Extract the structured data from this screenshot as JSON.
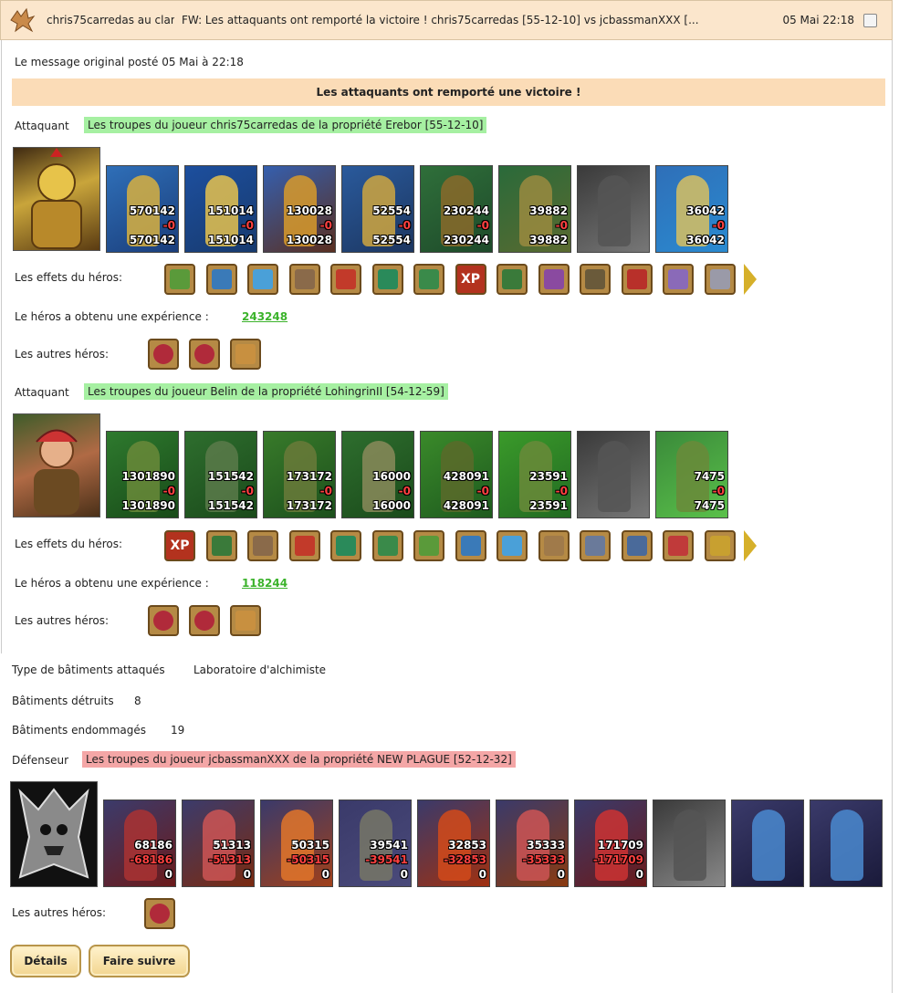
{
  "header": {
    "sender": "chris75carredas au clan",
    "subject": "FW: Les attaquants ont remporté la victoire ! chris75carredas [55-12-10] vs jcbassmanXXX [...",
    "date": "05 Mai 22:18"
  },
  "original_note": "Le message original posté 05 Mai à 22:18",
  "banner": "Les attaquants ont remporté une victoire !",
  "attackers": [
    {
      "label": "Attaquant",
      "troops": "Les troupes du joueur chris75carredas de la propriété Erebor [55-12-10]",
      "units": [
        {
          "a": "570142",
          "b": "-0",
          "c": "570142"
        },
        {
          "a": "151014",
          "b": "-0",
          "c": "151014"
        },
        {
          "a": "130028",
          "b": "-0",
          "c": "130028"
        },
        {
          "a": "52554",
          "b": "-0",
          "c": "52554"
        },
        {
          "a": "230244",
          "b": "-0",
          "c": "230244"
        },
        {
          "a": "39882",
          "b": "-0",
          "c": "39882"
        },
        {
          "a": "",
          "b": "",
          "c": ""
        },
        {
          "a": "36042",
          "b": "-0",
          "c": "36042"
        }
      ],
      "effects_label": "Les effets du héros:",
      "xp_label": "Le héros a obtenu une expérience :",
      "xp": "243248",
      "others_label": "Les autres héros:"
    },
    {
      "label": "Attaquant",
      "troops": "Les troupes du joueur Belin de la propriété LohingrinII [54-12-59]",
      "units": [
        {
          "a": "1301890",
          "b": "-0",
          "c": "1301890"
        },
        {
          "a": "151542",
          "b": "-0",
          "c": "151542"
        },
        {
          "a": "173172",
          "b": "-0",
          "c": "173172"
        },
        {
          "a": "16000",
          "b": "-0",
          "c": "16000"
        },
        {
          "a": "428091",
          "b": "-0",
          "c": "428091"
        },
        {
          "a": "23591",
          "b": "-0",
          "c": "23591"
        },
        {
          "a": "",
          "b": "",
          "c": ""
        },
        {
          "a": "7475",
          "b": "-0",
          "c": "7475"
        }
      ],
      "effects_label": "Les effets du héros:",
      "xp_label": "Le héros a obtenu une expérience :",
      "xp": "118244",
      "others_label": "Les autres héros:"
    }
  ],
  "buildings": {
    "type_label": "Type de bâtiments attaqués",
    "type_value": "Laboratoire d'alchimiste",
    "destroyed_label": "Bâtiments détruits",
    "destroyed_value": "8",
    "damaged_label": "Bâtiments endommagés",
    "damaged_value": "19"
  },
  "defender": {
    "label": "Défenseur",
    "troops": "Les troupes du joueur jcbassmanXXX de la propriété NEW PLAGUE [52-12-32]",
    "units": [
      {
        "a": "68186",
        "b": "-68186",
        "c": "0"
      },
      {
        "a": "51313",
        "b": "-51313",
        "c": "0"
      },
      {
        "a": "50315",
        "b": "-50315",
        "c": "0"
      },
      {
        "a": "39541",
        "b": "-39541",
        "c": "0"
      },
      {
        "a": "32853",
        "b": "-32853",
        "c": "0"
      },
      {
        "a": "35333",
        "b": "-35333",
        "c": "0"
      },
      {
        "a": "171709",
        "b": "-171709",
        "c": "0"
      },
      {
        "a": "",
        "b": "",
        "c": ""
      },
      {
        "a": "",
        "b": "",
        "c": ""
      },
      {
        "a": "",
        "b": "",
        "c": ""
      }
    ],
    "others_label": "Les autres héros:"
  },
  "buttons": {
    "details": "Détails",
    "forward": "Faire suivre"
  },
  "effect_text": {
    "xp": "XP"
  },
  "colors": {
    "header_bg": "#fbe6cc",
    "banner_bg": "#fbdcb7",
    "attacker_hl": "#a6f0a2",
    "defender_hl": "#f4a6a6",
    "xp_link": "#3cb32c"
  }
}
